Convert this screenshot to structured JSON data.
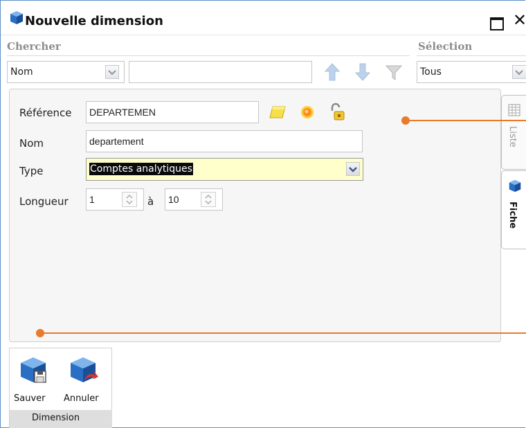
{
  "window": {
    "title": "Nouvelle dimension"
  },
  "search": {
    "section_label": "Chercher",
    "field_select": "Nom",
    "text_value": ""
  },
  "selection": {
    "section_label": "Sélection",
    "value": "Tous"
  },
  "form": {
    "reference_label": "Référence",
    "reference_value": "DEPARTEMEN",
    "nom_label": "Nom",
    "nom_value": "departement",
    "type_label": "Type",
    "type_value": "Comptes analytiques",
    "longueur_label": "Longueur",
    "longueur_from": "1",
    "longueur_sep": "à",
    "longueur_to": "10"
  },
  "side_tabs": {
    "liste_label": "Liste",
    "fiche_label": "Fiche"
  },
  "toolbar": {
    "save_label": "Sauver",
    "cancel_label": "Annuler",
    "group_label": "Dimension"
  },
  "colors": {
    "window_border": "#5b8fc7",
    "accent_orange": "#e87a2a",
    "type_highlight": "#ffffcc"
  }
}
